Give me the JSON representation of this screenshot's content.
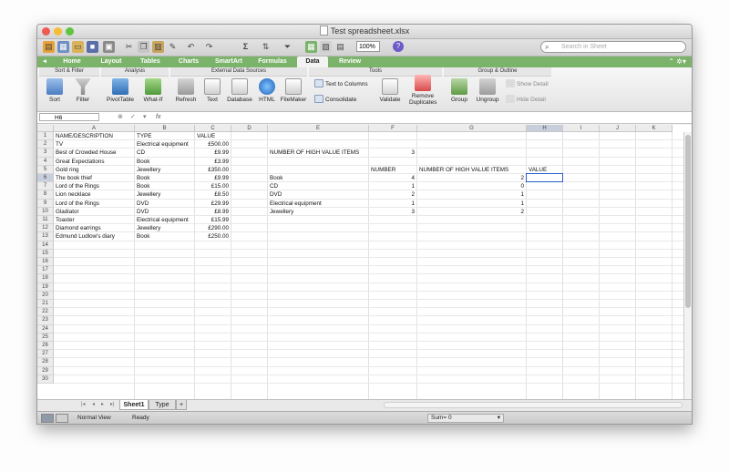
{
  "window": {
    "title": "Test spreadsheet.xlsx"
  },
  "toolbar": {
    "zoom_value": "100%",
    "search_placeholder": "Search in Sheet",
    "sum_symbol": "Σ",
    "help_symbol": "?"
  },
  "ribbon": {
    "tabs": [
      "Home",
      "Layout",
      "Tables",
      "Charts",
      "SmartArt",
      "Formulas",
      "Data",
      "Review"
    ],
    "active_tab": "Data",
    "groups": [
      {
        "name": "Sort & Filter",
        "buttons": [
          "Sort",
          "Filter"
        ]
      },
      {
        "name": "Analysis",
        "buttons": [
          "PivotTable",
          "What-If"
        ]
      },
      {
        "name": "External Data Sources",
        "buttons": [
          "Refresh",
          "Text",
          "Database",
          "HTML",
          "FileMaker"
        ]
      },
      {
        "name": "Tools",
        "buttons": [
          "Text to Columns",
          "Consolidate",
          "Validate",
          "Remove Duplicates"
        ]
      },
      {
        "name": "Group & Outline",
        "buttons": [
          "Group",
          "Ungroup",
          "Show Detail",
          "Hide Detail"
        ]
      }
    ]
  },
  "formula_bar": {
    "name_box": "H6",
    "fx_label": "fx",
    "value": ""
  },
  "grid": {
    "columns": [
      "A",
      "B",
      "C",
      "D",
      "E",
      "F",
      "G",
      "H",
      "I",
      "J",
      "K"
    ],
    "selected_column": "H",
    "selected_row": 6,
    "row_count": 30,
    "cells": [
      {
        "ref": "A1",
        "value": "NAME/DESCRIPTION"
      },
      {
        "ref": "B1",
        "value": "TYPE"
      },
      {
        "ref": "C1",
        "value": "VALUE"
      },
      {
        "ref": "A2",
        "value": "TV"
      },
      {
        "ref": "B2",
        "value": "Electrical equipment"
      },
      {
        "ref": "C2",
        "value": "£500.00",
        "align": "right"
      },
      {
        "ref": "A3",
        "value": "Best of Crowded House"
      },
      {
        "ref": "B3",
        "value": "CD"
      },
      {
        "ref": "C3",
        "value": "£9.99",
        "align": "right"
      },
      {
        "ref": "E3",
        "value": "NUMBER OF HIGH VALUE ITEMS"
      },
      {
        "ref": "F3",
        "value": "3",
        "align": "right"
      },
      {
        "ref": "A4",
        "value": "Great Expectations"
      },
      {
        "ref": "B4",
        "value": "Book"
      },
      {
        "ref": "C4",
        "value": "£3.99",
        "align": "right"
      },
      {
        "ref": "A5",
        "value": "Gold ring"
      },
      {
        "ref": "B5",
        "value": "Jewellery"
      },
      {
        "ref": "C5",
        "value": "£350.00",
        "align": "right"
      },
      {
        "ref": "F5",
        "value": "NUMBER"
      },
      {
        "ref": "G5",
        "value": "NUMBER OF HIGH VALUE ITEMS"
      },
      {
        "ref": "H5",
        "value": "VALUE"
      },
      {
        "ref": "A6",
        "value": "The book thief"
      },
      {
        "ref": "B6",
        "value": "Book"
      },
      {
        "ref": "C6",
        "value": "£9.99",
        "align": "right"
      },
      {
        "ref": "E6",
        "value": "Book"
      },
      {
        "ref": "F6",
        "value": "4",
        "align": "right"
      },
      {
        "ref": "G6",
        "value": "2",
        "align": "right"
      },
      {
        "ref": "A7",
        "value": "Lord of the Rings"
      },
      {
        "ref": "B7",
        "value": "Book"
      },
      {
        "ref": "C7",
        "value": "£15.00",
        "align": "right"
      },
      {
        "ref": "E7",
        "value": "CD"
      },
      {
        "ref": "F7",
        "value": "1",
        "align": "right"
      },
      {
        "ref": "G7",
        "value": "0",
        "align": "right"
      },
      {
        "ref": "A8",
        "value": "Lion necklace"
      },
      {
        "ref": "B8",
        "value": "Jewellery"
      },
      {
        "ref": "C8",
        "value": "£8.50",
        "align": "right"
      },
      {
        "ref": "E8",
        "value": "DVD"
      },
      {
        "ref": "F8",
        "value": "2",
        "align": "right"
      },
      {
        "ref": "G8",
        "value": "1",
        "align": "right"
      },
      {
        "ref": "A9",
        "value": "Lord of the Rings"
      },
      {
        "ref": "B9",
        "value": "DVD"
      },
      {
        "ref": "C9",
        "value": "£29.99",
        "align": "right"
      },
      {
        "ref": "E9",
        "value": "Electrical equipment"
      },
      {
        "ref": "F9",
        "value": "1",
        "align": "right"
      },
      {
        "ref": "G9",
        "value": "1",
        "align": "right"
      },
      {
        "ref": "A10",
        "value": "Gladiator"
      },
      {
        "ref": "B10",
        "value": "DVD"
      },
      {
        "ref": "C10",
        "value": "£8.99",
        "align": "right"
      },
      {
        "ref": "E10",
        "value": "Jewellery"
      },
      {
        "ref": "F10",
        "value": "3",
        "align": "right"
      },
      {
        "ref": "G10",
        "value": "2",
        "align": "right"
      },
      {
        "ref": "A11",
        "value": "Toaster"
      },
      {
        "ref": "B11",
        "value": "Electrical equipment"
      },
      {
        "ref": "C11",
        "value": "£15.99",
        "align": "right"
      },
      {
        "ref": "A12",
        "value": "Diamond earrings"
      },
      {
        "ref": "B12",
        "value": "Jewellery"
      },
      {
        "ref": "C12",
        "value": "£290.00",
        "align": "right"
      },
      {
        "ref": "A13",
        "value": "Edmund Ludlow's diary"
      },
      {
        "ref": "B13",
        "value": "Book"
      },
      {
        "ref": "C13",
        "value": "£250.00",
        "align": "right"
      }
    ]
  },
  "sheets": {
    "tabs": [
      "Sheet1",
      "Type"
    ],
    "active": "Sheet1",
    "add_label": "+"
  },
  "status_bar": {
    "view": "Normal View",
    "state": "Ready",
    "sum": "Sum= 0"
  },
  "colors": {
    "ribbon_green": "#7bb36a",
    "selection_blue": "#2a5ec9"
  }
}
